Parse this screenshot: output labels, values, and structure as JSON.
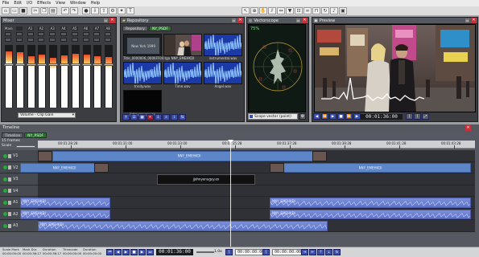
{
  "menu": [
    "File",
    "Edit",
    "I/O",
    "Effects",
    "View",
    "Window",
    "Help"
  ],
  "mixer": {
    "title": "Mixer",
    "channels": [
      "Main",
      "",
      "A1",
      "A2",
      "A3",
      "A4",
      "A5",
      "A6",
      "A7",
      "A8"
    ],
    "levels": [
      0.9,
      0.88,
      0.82,
      0.84,
      0.8,
      0.83,
      0.86,
      0.84,
      0.82,
      0.81
    ],
    "select_value": "Volume - Clip Gain"
  },
  "repository": {
    "title": "Repository",
    "tabs": [
      "Repository",
      "NY_PSDF"
    ],
    "items": [
      {
        "label": "Title_0000006_0006FF04.tga",
        "kind": "video"
      },
      {
        "label": "NNY_EMEHKDI",
        "kind": "video2"
      },
      {
        "label": "instrumental.wav",
        "kind": "audio"
      },
      {
        "label": "trinity.wav",
        "kind": "audio"
      },
      {
        "label": "Time.wav",
        "kind": "audio"
      },
      {
        "label": "Angel.wav",
        "kind": "audio"
      },
      {
        "label": "jjohnyenuguy.ex",
        "kind": "black"
      }
    ]
  },
  "scope": {
    "title": "Vectorscope",
    "percent": "75%",
    "select_value": "Scope vector (point)"
  },
  "preview": {
    "title": "Preview",
    "timecode": "00:01:36:00"
  },
  "timeline": {
    "title": "Timeline",
    "tabs": [
      "Timeline",
      "NY_PSDF"
    ],
    "frames_label": "15 frames",
    "scale_label": "Scale",
    "ruler": [
      "00:01:28:28",
      "00:01:31:00",
      "00:01:33:00",
      "00:01:35:28",
      "00:01:37:28",
      "00:01:39:28",
      "00:01:41:28",
      "00:01:43:28"
    ],
    "tracks": [
      {
        "name": "V1"
      },
      {
        "name": "V2"
      },
      {
        "name": "V3"
      },
      {
        "name": "V4"
      },
      {
        "name": "A1"
      },
      {
        "name": "A2"
      },
      {
        "name": "A3"
      }
    ],
    "clip_names": {
      "v1": "NNY_EMEHKDI",
      "v2a": "NNY_EMEHKDI",
      "v2b": "NNY_EMEHKDI",
      "v3": "jjohnyenuguy.ex",
      "a1a": "NNY_EMEHKDI",
      "a1b": "NNY_EMEHKDI",
      "a2a": "NNY_EMEHKDI",
      "a2b": "NNY_EMEHKDI",
      "a3": "NNY_EMEHKDI"
    }
  },
  "status": {
    "timecode": "00:01:36:00",
    "speed": "1.0x",
    "in_tc": "00:00:00:00",
    "out_tc": "00:00:00:00",
    "fields": [
      {
        "label": "Scale Mark",
        "value": "00:00:00:00"
      },
      {
        "label": "Mark Dur.",
        "value": "00:00:36:17"
      },
      {
        "label": "Duration",
        "value": "00:00:36:17"
      },
      {
        "label": "Timecode",
        "value": "00:00:00:00"
      },
      {
        "label": "Duration",
        "value": "00:00:00:00"
      }
    ]
  }
}
